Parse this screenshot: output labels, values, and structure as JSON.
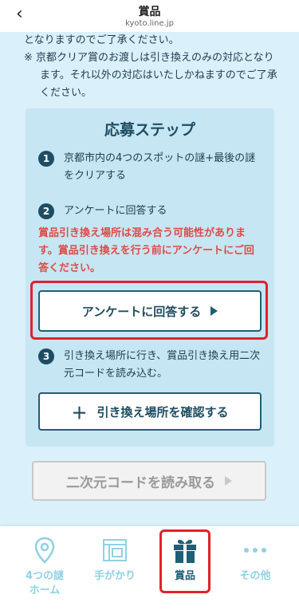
{
  "header": {
    "back_icon": "‹",
    "title": "賞品",
    "domain": "kyoto.line.jp"
  },
  "notes": {
    "line1": "となりますのでご了承ください。",
    "item": "※ 京都クリア賞のお渡しは引き換えのみの対応となります。それ以外の対応はいたしかねますのでご了承ください。"
  },
  "steps": {
    "heading": "応募ステップ",
    "step1": {
      "num": "1",
      "text": "京都市内の4つのスポットの謎+最後の謎をクリアする"
    },
    "step2": {
      "num": "2",
      "text": "アンケートに回答する"
    },
    "warning": "賞品引き換え場所は混み合う可能性があります。賞品引き換えを行う前にアンケートにご回答ください。",
    "survey_button": "アンケートに回答する",
    "step3": {
      "num": "3",
      "text": "引き換え場所に行き、賞品引き換え用二次元コードを読み込む。"
    },
    "locations_button": "引き換え場所を確認する",
    "locations_plus": "＋"
  },
  "qr_button": "二次元コードを読み取る",
  "nav": {
    "items": [
      {
        "label": "4つの謎\nホーム",
        "icon": "map-pin-icon"
      },
      {
        "label": "手がかり",
        "icon": "clue-icon"
      },
      {
        "label": "賞品",
        "icon": "gift-icon",
        "active": true
      },
      {
        "label": "その他",
        "icon": "more-icon"
      }
    ],
    "label0_line1": "4つの謎",
    "label0_line2": "ホーム",
    "label1": "手がかり",
    "label2": "賞品",
    "label3": "その他"
  },
  "colors": {
    "primary": "#1e5f77",
    "background": "#daf0fa",
    "card": "#c6e6f3",
    "warning": "#e04b47",
    "highlight": "#e2212d",
    "nav_inactive": "#8fd1e4"
  }
}
